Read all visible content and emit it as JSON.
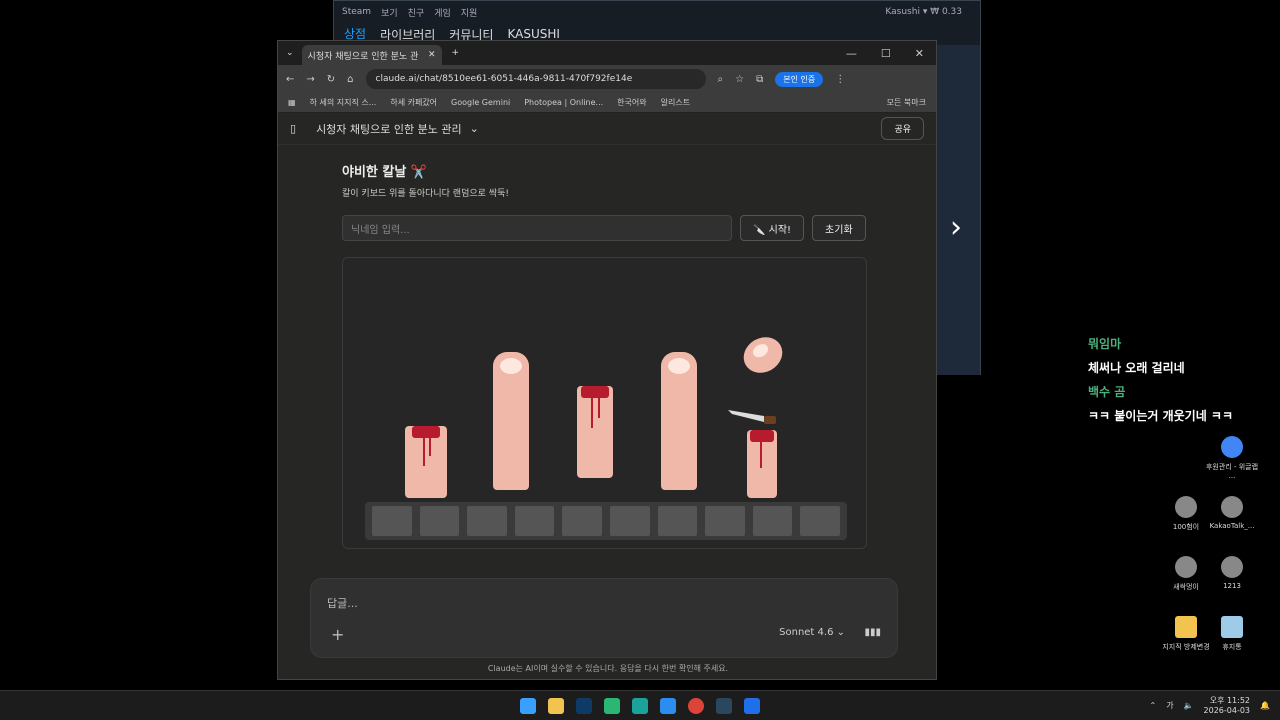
{
  "steam": {
    "menu": [
      "Steam",
      "보기",
      "친구",
      "게임",
      "지원"
    ],
    "nav": [
      "상점",
      "라이브러리",
      "커뮤니티",
      "KASUSHI"
    ],
    "user": "Kasushi ▾ ₩ 0.33"
  },
  "browser": {
    "tab_title": "시청자 채팅으로 인한 분노 관",
    "url": "claude.ai/chat/8510ee61-6051-446a-9811-470f792fe14e",
    "verify_label": "본인 인증",
    "bookmarks": [
      "하 세의 지지직 스...",
      "하세 카페갔어",
      "Google Gemini",
      "Photopea | Online...",
      "한국어와",
      "알리스트"
    ],
    "all_bookmarks": "모든 북마크"
  },
  "claude": {
    "chat_title": "시청자 채팅으로 인한 분노 관리",
    "share": "공유",
    "artifact_title": "야비한 칼날 ✂️",
    "artifact_sub": "칼이 키보드 위를 돌아다니다 랜덤으로 싹둑!",
    "nick_placeholder": "닉네임 입력...",
    "start_btn": "🔪 시작!",
    "reset_btn": "초기화",
    "reply_placeholder": "답글...",
    "model": "Sonnet 4.6 ⌄",
    "disclaimer": "Claude는 AI이며 실수할 수 있습니다. 응답을 다시 한번 확인해 주세요."
  },
  "chatlog": [
    {
      "name": "뭐임마",
      "msg": "체써나 오래 걸리네"
    },
    {
      "name": "백수 곰",
      "msg": "ㅋㅋ 붙이는거 개웃기네 ㅋㅋ"
    }
  ],
  "desktop_icons": [
    "후원관리 - 위글랩 ...",
    "100험이",
    "KakaoTalk_...",
    "새싹멍이",
    "1213",
    "지지직 방제변경",
    "휴지통"
  ],
  "taskbar": {
    "time": "오후 11:52",
    "date": "2026-04-03",
    "ime": "가"
  },
  "colors": {
    "accent": "#1a9fff",
    "blood": "#b71c2e",
    "skin": "#f0b8a8",
    "chat_name": "#4caf7d"
  }
}
